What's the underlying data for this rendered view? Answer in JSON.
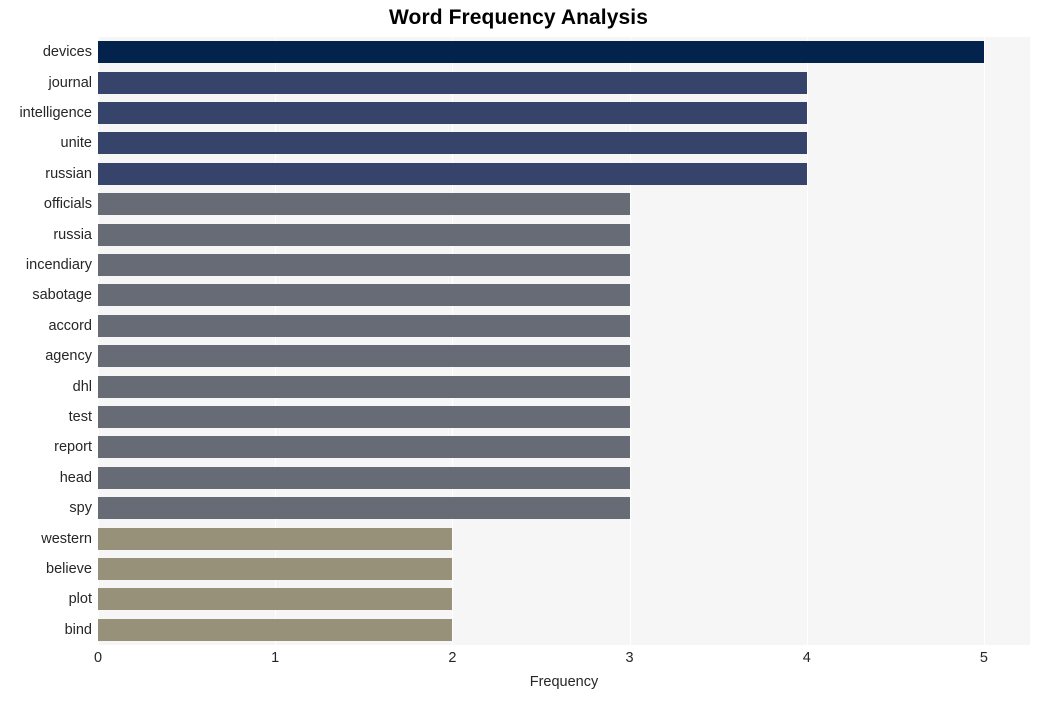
{
  "chart_data": {
    "type": "bar",
    "orientation": "horizontal",
    "title": "Word Frequency Analysis",
    "xlabel": "Frequency",
    "ylabel": "",
    "xlim": [
      0,
      5.26
    ],
    "xticks": [
      0,
      1,
      2,
      3,
      4,
      5
    ],
    "xtick_labels": [
      "0",
      "1",
      "2",
      "3",
      "4",
      "5"
    ],
    "grid": true,
    "grid_axis": "x",
    "legend": false,
    "categories": [
      "devices",
      "journal",
      "intelligence",
      "unite",
      "russian",
      "officials",
      "russia",
      "incendiary",
      "sabotage",
      "accord",
      "agency",
      "dhl",
      "test",
      "report",
      "head",
      "spy",
      "western",
      "believe",
      "plot",
      "bind"
    ],
    "values": [
      5,
      4,
      4,
      4,
      4,
      3,
      3,
      3,
      3,
      3,
      3,
      3,
      3,
      3,
      3,
      3,
      2,
      2,
      2,
      2
    ],
    "bar_colors": [
      "#03224c",
      "#36446c",
      "#36446c",
      "#36446c",
      "#36446c",
      "#666b76",
      "#666b76",
      "#666b76",
      "#666b76",
      "#666b76",
      "#666b76",
      "#666b76",
      "#666b76",
      "#666b76",
      "#666b76",
      "#666b76",
      "#979179",
      "#979179",
      "#979179",
      "#979179"
    ],
    "plot_background": "#f6f6f7",
    "gridline_color": "#ffffff",
    "text_color": "#262626"
  }
}
